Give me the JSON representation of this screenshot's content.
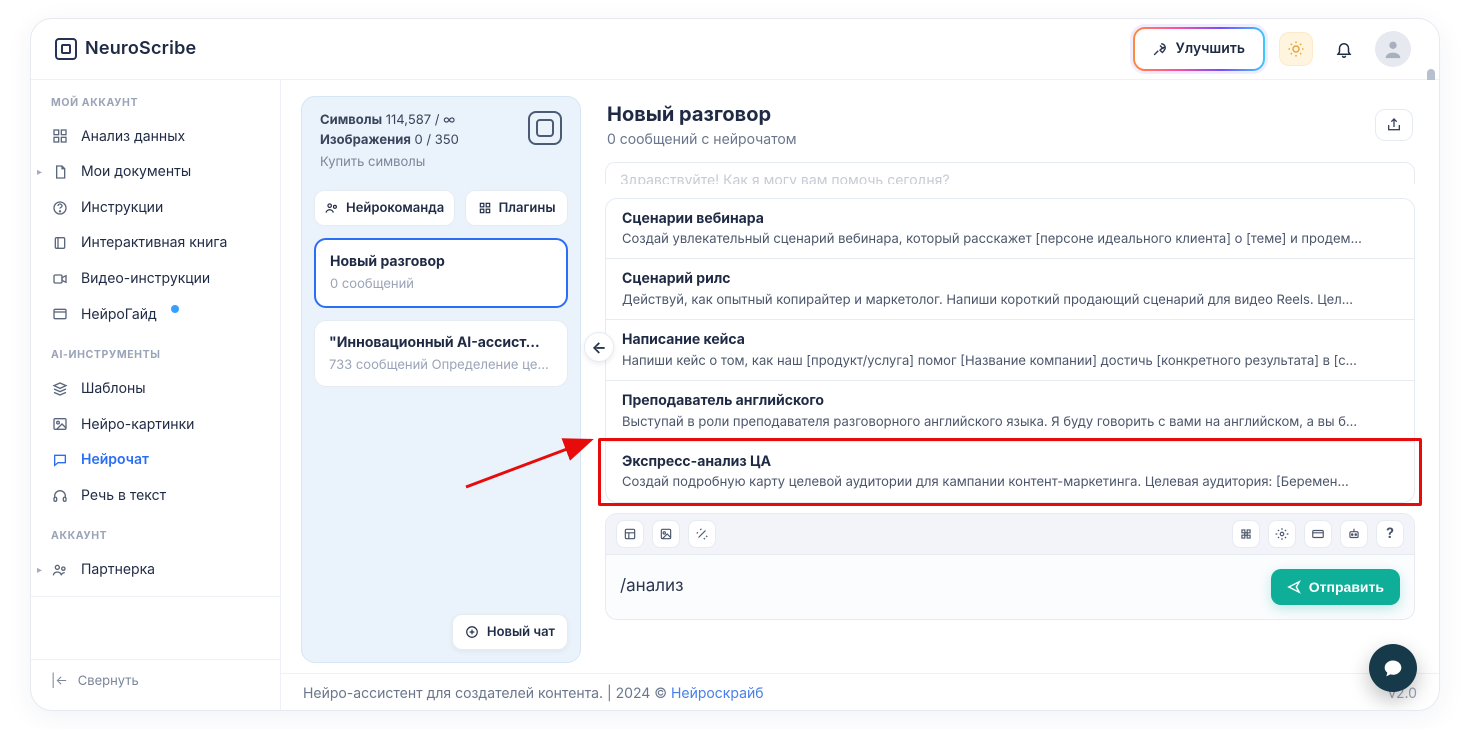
{
  "brand": {
    "name": "NeuroScribe"
  },
  "topbar": {
    "upgrade_label": "Улучшить"
  },
  "sidebar": {
    "sections": {
      "account": "МОЙ АККАУНТ",
      "ai_tools": "AI-ИНСТРУМЕНТЫ",
      "acct2": "АККАУНТ"
    },
    "items": {
      "data_analysis": "Анализ данных",
      "documents": "Мои документы",
      "instructions": "Инструкции",
      "ibook": "Интерактивная книга",
      "video_instr": "Видео-инструкции",
      "neuroguide": "НейроГайд",
      "templates": "Шаблоны",
      "neuro_images": "Нейро-картинки",
      "neurochat": "Нейрочат",
      "speech2text": "Речь в текст",
      "partner": "Партнерка"
    },
    "collapse": "Свернуть"
  },
  "left_panel": {
    "symbols_label": "Символы",
    "symbols_value": "114,587 / ∞",
    "images_label": "Изображения",
    "images_value": "0 / 350",
    "buy_link": "Купить символы",
    "team_btn": "Нейрокоманда",
    "plugins_btn": "Плагины",
    "new_chat_btn": "Новый чат",
    "conversations": [
      {
        "title": "Новый разговор",
        "sub": "0 сообщений",
        "active": true
      },
      {
        "title": "\"Инновационный AI-ассист…",
        "sub": "733 сообщений Определение целевы…",
        "active": false
      }
    ]
  },
  "chat": {
    "title": "Новый разговор",
    "sub": "0 сообщений с нейрочатом",
    "greet_ghost": "Здравствуйте! Как я могу вам помочь сегодня?",
    "suggestions": [
      {
        "t": "Сценарии вебинара",
        "d": "Создай увлекательный сценарий вебинара, который расскажет [персоне идеального клиента] о [теме] и продем…"
      },
      {
        "t": "Сценарий рилс",
        "d": "Действуй, как опытный копирайтер и маркетолог. Напиши короткий продающий сценарий для видео Reels. Цел…"
      },
      {
        "t": "Написание кейса",
        "d": "Напиши кейс о том, как наш [продукт/услуга] помог [Название компании] достичь [конкретного результата] в [с…"
      },
      {
        "t": "Преподаватель английского",
        "d": "Выступай в роли преподавателя разговорного английского языка. Я буду говорить с вами на английском, а вы б…"
      },
      {
        "t": "Экспресс-анализ ЦА",
        "d": "Создай подробную карту целевой аудитории для кампании контент-маркетинга. Целевая аудитория: [Беремен…"
      }
    ],
    "input_value": "/анализ",
    "send_label": "Отправить"
  },
  "footer": {
    "text_left": "Нейро-ассистент для создателей контента.  | 2024 © ",
    "link": "Нейроскрайб",
    "version": "v2.0"
  }
}
